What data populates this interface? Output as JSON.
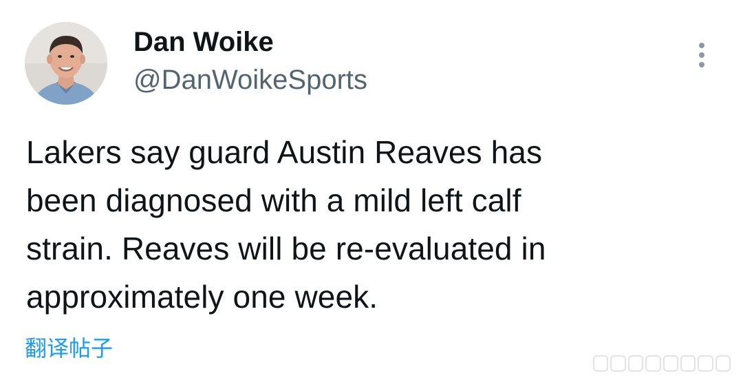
{
  "author": {
    "name": "Dan Woike",
    "handle": "@DanWoikeSports",
    "avatar": "profile-photo"
  },
  "tweet": {
    "lines": [
      "Lakers say guard Austin Reaves has",
      "been diagnosed with a mild left calf",
      "strain. Reaves will be re-evaluated in",
      "approximately one week."
    ]
  },
  "actions": {
    "more_icon": "more-vertical-icon",
    "translate_label": "翻译帖子"
  },
  "colors": {
    "text": "#0f1419",
    "secondary": "#536471",
    "link": "#1d9bf0"
  }
}
